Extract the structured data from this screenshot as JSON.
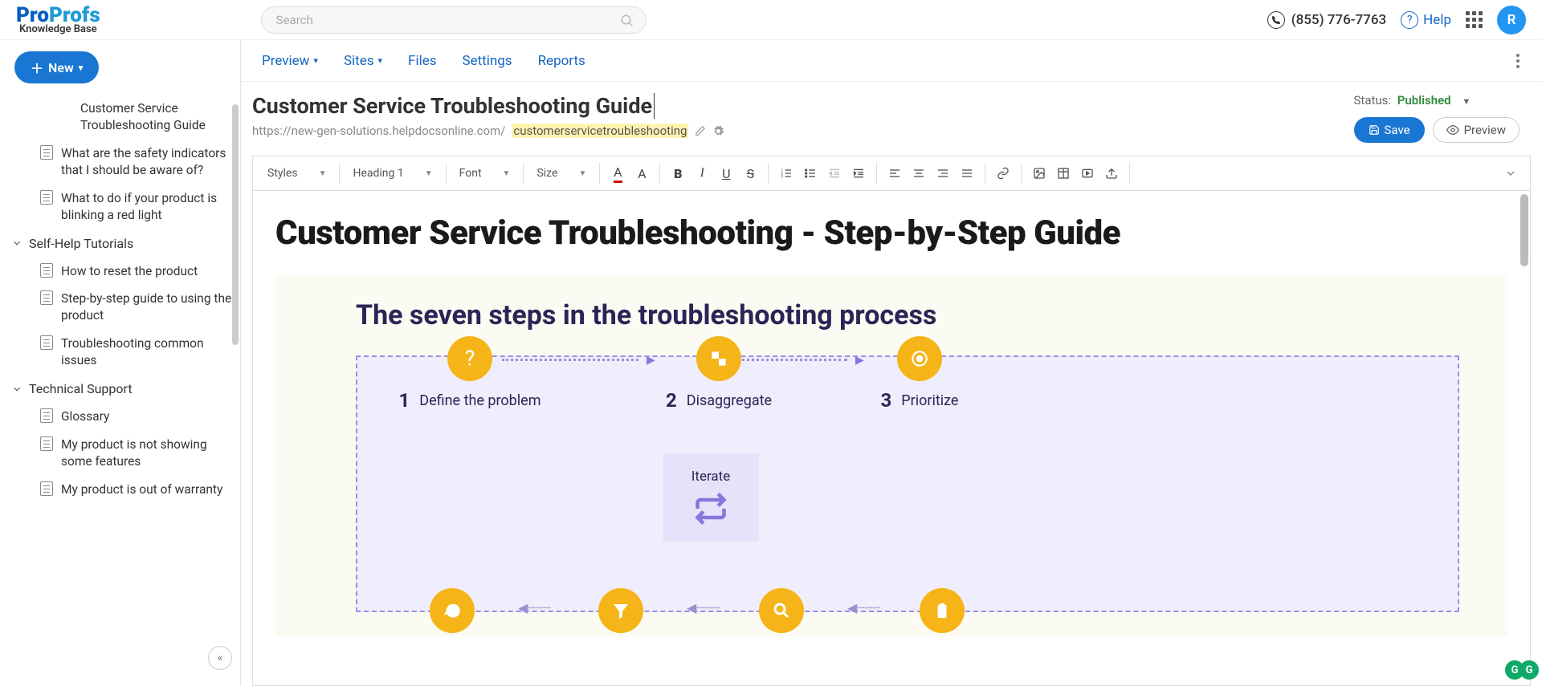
{
  "brand": {
    "pro": "Pro",
    "profs": "Profs",
    "sub": "Knowledge Base"
  },
  "search": {
    "placeholder": "Search"
  },
  "top": {
    "phone": "(855) 776-7763",
    "help": "Help",
    "avatar": "R"
  },
  "newBtn": "New",
  "sidebar": {
    "items": [
      {
        "label": "Customer Service Troubleshooting Guide"
      },
      {
        "label": "What are the safety indicators that I should be aware of?"
      },
      {
        "label": "What to do if your product is blinking a red light"
      }
    ],
    "folders": [
      {
        "label": "Self-Help Tutorials",
        "items": [
          {
            "label": "How to reset the product"
          },
          {
            "label": "Step-by-step guide to using the product"
          },
          {
            "label": "Troubleshooting common issues"
          }
        ]
      },
      {
        "label": "Technical Support",
        "items": [
          {
            "label": "Glossary"
          },
          {
            "label": "My product is not showing some features"
          },
          {
            "label": "My product is out of warranty"
          }
        ]
      }
    ]
  },
  "menu": {
    "preview": "Preview",
    "sites": "Sites",
    "files": "Files",
    "settings": "Settings",
    "reports": "Reports"
  },
  "page": {
    "title": "Customer Service Troubleshooting Guide",
    "urlBase": "https://new-gen-solutions.helpdocsonline.com/",
    "urlSlug": "customerservicetroubleshooting",
    "statusLabel": "Status:",
    "statusValue": "Published",
    "save": "Save",
    "preview": "Preview"
  },
  "toolbar": {
    "styles": "Styles",
    "heading": "Heading 1",
    "font": "Font",
    "size": "Size"
  },
  "content": {
    "h1": "Customer Service Troubleshooting - Step-by-Step Guide",
    "infoTitle": "The seven steps in the troubleshooting process",
    "steps": [
      {
        "n": "1",
        "label": "Define the problem"
      },
      {
        "n": "2",
        "label": "Disaggregate"
      },
      {
        "n": "3",
        "label": "Prioritize"
      }
    ],
    "iterate": "Iterate"
  }
}
